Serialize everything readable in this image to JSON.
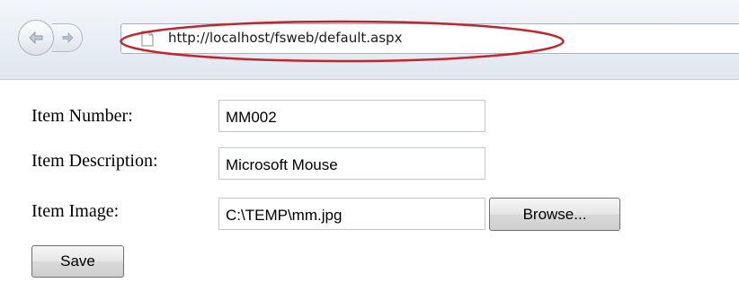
{
  "browser": {
    "url": "http://localhost/fsweb/default.aspx",
    "highlight_color": "#c0262d",
    "icons": {
      "back": "back-arrow-icon",
      "forward": "forward-arrow-icon",
      "page": "page-icon"
    }
  },
  "form": {
    "item_number": {
      "label": "Item Number:",
      "value": "MM002"
    },
    "item_description": {
      "label": "Item Description:",
      "value": "Microsoft Mouse"
    },
    "item_image": {
      "label": "Item Image:",
      "value": "C:\\TEMP\\mm.jpg",
      "browse_label": "Browse..."
    },
    "save_label": "Save"
  }
}
